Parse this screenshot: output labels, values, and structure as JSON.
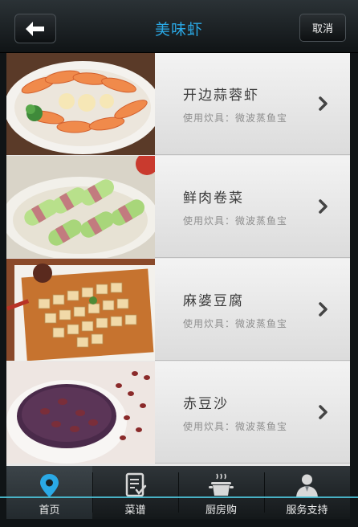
{
  "header": {
    "title": "美味虾",
    "back_icon": "arrow-left-icon",
    "cancel_label": "取消"
  },
  "recipes": [
    {
      "name": "开边蒜蓉虾",
      "cookware": "使用炊具：微波蒸鱼宝"
    },
    {
      "name": "鲜肉卷菜",
      "cookware": "使用炊具：微波蒸鱼宝"
    },
    {
      "name": "麻婆豆腐",
      "cookware": "使用炊具：微波蒸鱼宝"
    },
    {
      "name": "赤豆沙",
      "cookware": "使用炊具：微波蒸鱼宝"
    }
  ],
  "tabbar": {
    "tabs": [
      {
        "label": "首页",
        "icon": "location-pin-icon",
        "active": true
      },
      {
        "label": "菜谱",
        "icon": "recipe-book-icon",
        "active": false
      },
      {
        "label": "厨房购",
        "icon": "cooking-pot-icon",
        "active": false
      },
      {
        "label": "服务支持",
        "icon": "user-support-icon",
        "active": false
      }
    ]
  },
  "colors": {
    "title": "#2aa9e6",
    "active_tab_icon": "#2aa9e6",
    "bar_background": "#14181a"
  }
}
